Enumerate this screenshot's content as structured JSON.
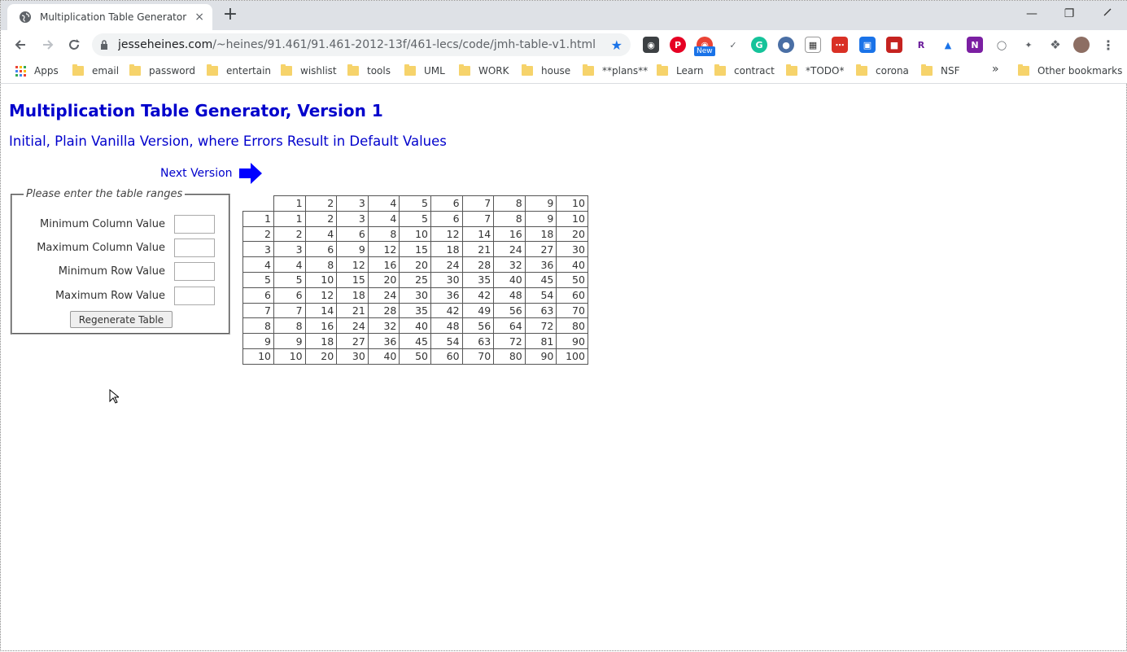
{
  "browser": {
    "tab_title": "Multiplication Table Generator - V",
    "tab_close": "×",
    "new_tab": "+",
    "url_host": "jesseheines.com",
    "url_path": "/~heines/91.461/91.461-2012-13f/461-lecs/code/jmh-table-v1.html",
    "extension_badge": "New",
    "bookmarks": [
      "Apps",
      "email",
      "password",
      "entertain",
      "wishlist",
      "tools",
      "UML",
      "WORK",
      "house",
      "**plans**",
      "Learn",
      "contract",
      "*TODO*",
      "corona",
      "NSF"
    ],
    "overflow": "»",
    "other_bookmarks": "Other bookmarks"
  },
  "page": {
    "title": "Multiplication Table Generator, Version 1",
    "subtitle": "Initial, Plain Vanilla Version, where Errors Result in Default Values",
    "next_version": "Next Version",
    "form": {
      "legend": "Please enter the table ranges",
      "fields": [
        {
          "label": "Minimum Column Value",
          "value": ""
        },
        {
          "label": "Maximum Column Value",
          "value": ""
        },
        {
          "label": "Minimum Row Value",
          "value": ""
        },
        {
          "label": "Maximum Row Value",
          "value": ""
        }
      ],
      "button": "Regenerate Table"
    },
    "table": {
      "columns": [
        "1",
        "2",
        "3",
        "4",
        "5",
        "6",
        "7",
        "8",
        "9",
        "10"
      ],
      "rows": [
        {
          "h": "1",
          "v": [
            "1",
            "2",
            "3",
            "4",
            "5",
            "6",
            "7",
            "8",
            "9",
            "10"
          ]
        },
        {
          "h": "2",
          "v": [
            "2",
            "4",
            "6",
            "8",
            "10",
            "12",
            "14",
            "16",
            "18",
            "20"
          ]
        },
        {
          "h": "3",
          "v": [
            "3",
            "6",
            "9",
            "12",
            "15",
            "18",
            "21",
            "24",
            "27",
            "30"
          ]
        },
        {
          "h": "4",
          "v": [
            "4",
            "8",
            "12",
            "16",
            "20",
            "24",
            "28",
            "32",
            "36",
            "40"
          ]
        },
        {
          "h": "5",
          "v": [
            "5",
            "10",
            "15",
            "20",
            "25",
            "30",
            "35",
            "40",
            "45",
            "50"
          ]
        },
        {
          "h": "6",
          "v": [
            "6",
            "12",
            "18",
            "24",
            "30",
            "36",
            "42",
            "48",
            "54",
            "60"
          ]
        },
        {
          "h": "7",
          "v": [
            "7",
            "14",
            "21",
            "28",
            "35",
            "42",
            "49",
            "56",
            "63",
            "70"
          ]
        },
        {
          "h": "8",
          "v": [
            "8",
            "16",
            "24",
            "32",
            "40",
            "48",
            "56",
            "64",
            "72",
            "80"
          ]
        },
        {
          "h": "9",
          "v": [
            "9",
            "18",
            "27",
            "36",
            "45",
            "54",
            "63",
            "72",
            "81",
            "90"
          ]
        },
        {
          "h": "10",
          "v": [
            "10",
            "20",
            "30",
            "40",
            "50",
            "60",
            "70",
            "80",
            "90",
            "100"
          ]
        }
      ]
    }
  },
  "colors": {
    "heading": "#0000cc",
    "tabstrip": "#dee1e6",
    "omnibox": "#f1f3f4",
    "star": "#1a73e8"
  }
}
